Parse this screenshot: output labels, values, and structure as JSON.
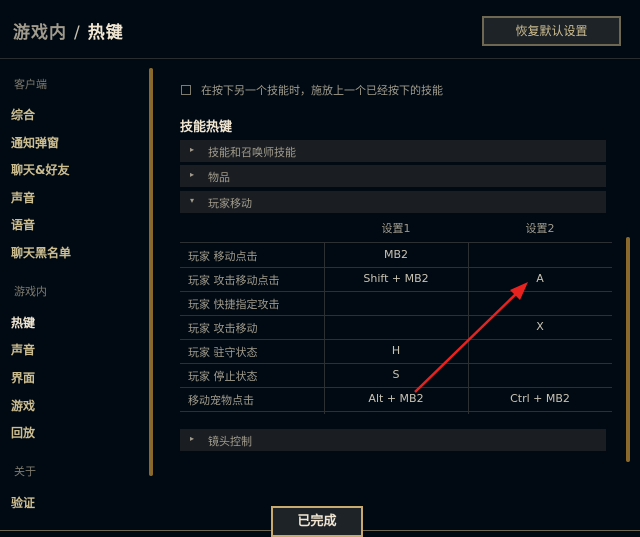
{
  "header": {
    "breadcrumb_parent": "游戏内",
    "breadcrumb_sep": "/",
    "breadcrumb_current": "热键",
    "restore_button": "恢复默认设置"
  },
  "sidebar": {
    "groups": [
      {
        "label": "客户端",
        "items": [
          "综合",
          "通知弹窗",
          "聊天&好友",
          "声音",
          "语音",
          "聊天黑名单"
        ]
      },
      {
        "label": "游戏内",
        "items": [
          "热键",
          "声音",
          "界面",
          "游戏",
          "回放"
        ]
      },
      {
        "label": "关于",
        "items": [
          "验证"
        ]
      }
    ],
    "active_item": "热键"
  },
  "main": {
    "checkbox_label": "在按下另一个技能时，施放上一个已经按下的技能",
    "checkbox_checked": false,
    "section_title": "技能热键",
    "accordions": [
      {
        "label": "技能和召唤师技能",
        "expanded": false
      },
      {
        "label": "物品",
        "expanded": false
      },
      {
        "label": "玩家移动",
        "expanded": true
      },
      {
        "label": "镜头控制",
        "expanded": false
      }
    ],
    "table": {
      "headers": [
        "",
        "设置1",
        "设置2"
      ],
      "rows": [
        {
          "name": "玩家 移动点击",
          "key1": "MB2",
          "key2": ""
        },
        {
          "name": "玩家 攻击移动点击",
          "key1": "Shift + MB2",
          "key2": "A"
        },
        {
          "name": "玩家 快捷指定攻击",
          "key1": "",
          "key2": ""
        },
        {
          "name": "玩家 攻击移动",
          "key1": "",
          "key2": "X"
        },
        {
          "name": "玩家 驻守状态",
          "key1": "H",
          "key2": ""
        },
        {
          "name": "玩家 停止状态",
          "key1": "S",
          "key2": ""
        },
        {
          "name": "移动宠物点击",
          "key1": "Alt + MB2",
          "key2": "Ctrl + MB2"
        }
      ]
    }
  },
  "footer": {
    "done_button": "已完成"
  },
  "colors": {
    "accent_gold": "#c8aa6e",
    "background": "#010a13",
    "annotation_arrow": "#e8231f"
  }
}
